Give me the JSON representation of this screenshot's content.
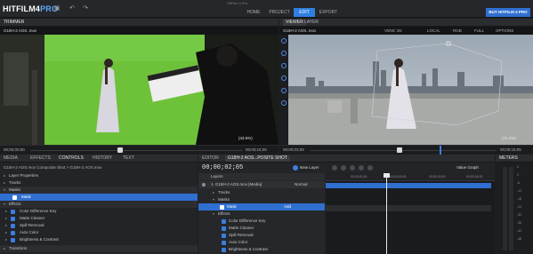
{
  "window_title": "HitFilm 4 Pro",
  "app": {
    "logo_main": "HITFILM",
    "logo_num": "4",
    "logo_pro": "PRO"
  },
  "nav": {
    "home": "HOME",
    "project": "PROJECT",
    "edit": "EDIT",
    "export": "EXPORT",
    "buy": "BUY HITFILM 4 PRO"
  },
  "trimmer": {
    "tab": "TRIMMER",
    "clip": "G18H-2 AOS..mov",
    "zoom": "(43.5%)",
    "time_start": "00;00;00;00",
    "time_end": "00;00;15;05"
  },
  "viewer": {
    "tab_viewer": "VIEWER",
    "tab_layer": "LAYER",
    "clip": "G18H-2 AOS..mov",
    "view_mode": "VIEW: 2D",
    "space": "LOCAL",
    "channels": "RGB",
    "quality": "FULL",
    "options": "OPTIONS",
    "zoom": "(41.2%)",
    "time_start": "00;00;03;09",
    "time_end": "00;00;15;05"
  },
  "media_panel": {
    "tabs": [
      "MEDIA",
      "EFFECTS",
      "CONTROLS",
      "HISTORY",
      "TEXT"
    ],
    "breadcrumb": "G18H-2 AOS.mov Composite Shot > G18H-2 AOS.mov",
    "rows": {
      "layer_props": "Layer Properties",
      "tracks": "Tracks",
      "masks": "Masks",
      "mask": "Mask",
      "effects": "Effects",
      "effect_items": [
        "Color Difference Key",
        "Matte Cleaner",
        "Spill Removal",
        "Auto Color",
        "Brightness & Contrast"
      ],
      "transform": "Transform"
    }
  },
  "editor_panel": {
    "tab_editor": "EDITOR",
    "tab_comp": "G18H-2 AOS...POSITE SHOT",
    "timecode": "00;00;02;05",
    "new_layer": "New Layer",
    "value_graph": "Value Graph",
    "layers_label": "Layers",
    "layer_name": "1. G18H-2 AOS.mov [Media]",
    "blend": "Normal",
    "rows": {
      "tracks": "Tracks",
      "masks": "Masks",
      "mask": "Mask",
      "add": "Add",
      "effects": "Effects",
      "effect_items": [
        "Color Difference Key",
        "Matte Cleaner",
        "Spill Removal",
        "Auto Color",
        "Brightness & Contrast"
      ]
    },
    "ruler": [
      "00;00;01;00",
      "00;00;02;00",
      "00;00;03;00",
      "00;00;04;00"
    ]
  },
  "meters": {
    "tab": "METERS",
    "scale": [
      "6",
      "0",
      "-6",
      "-12",
      "-18",
      "-24",
      "-30",
      "-36",
      "-42",
      "-48"
    ]
  },
  "colors": {
    "accent": "#2f7fe0",
    "greenscreen": "#6ec23a",
    "sky": "#b9c3cd"
  }
}
